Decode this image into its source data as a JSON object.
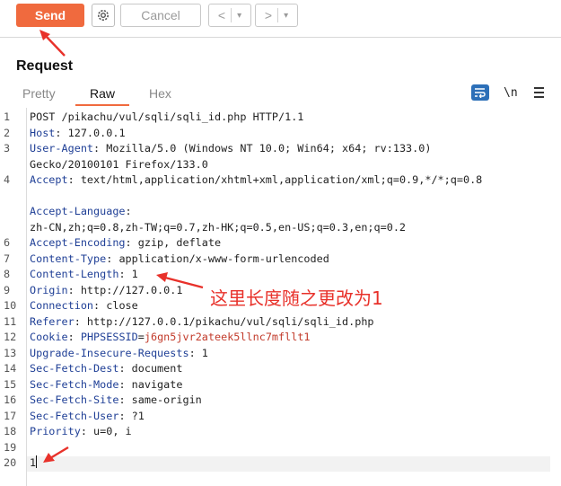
{
  "toolbar": {
    "send_label": "Send",
    "cancel_label": "Cancel",
    "back_glyph": "<",
    "forward_glyph": ">",
    "dropdown_glyph": "▾",
    "settings_icon": "gear-icon"
  },
  "section_title": "Request",
  "tabs": {
    "pretty": "Pretty",
    "raw": "Raw",
    "hex": "Hex",
    "newline_toggle": "\\n"
  },
  "colors": {
    "accent": "#f06a3e",
    "header_key": "#1f3f96",
    "cookie_value": "#c23a2a",
    "annotation": "#e8312a",
    "wrap_button": "#2c6fb8"
  },
  "annotation_note": "这里长度随之更改为1",
  "request_lines": [
    {
      "num": "1",
      "key": "",
      "value": "POST /pikachu/vul/sqli/sqli_id.php HTTP/1.1"
    },
    {
      "num": "2",
      "key": "Host",
      "value": ": 127.0.0.1"
    },
    {
      "num": "3",
      "key": "User-Agent",
      "value": ": Mozilla/5.0 (Windows NT 10.0; Win64; x64; rv:133.0)"
    },
    {
      "num": "",
      "key": "",
      "value": "Gecko/20100101 Firefox/133.0"
    },
    {
      "num": "4",
      "key": "Accept",
      "value": ": text/html,application/xhtml+xml,application/xml;q=0.9,*/*;q=0.8"
    },
    {
      "num": "",
      "key": "",
      "value": ""
    },
    {
      "num": "",
      "key": "Accept-Language",
      "value": ":"
    },
    {
      "num": "",
      "key": "",
      "value": "zh-CN,zh;q=0.8,zh-TW;q=0.7,zh-HK;q=0.5,en-US;q=0.3,en;q=0.2"
    },
    {
      "num": "6",
      "key": "Accept-Encoding",
      "value": ": gzip, deflate"
    },
    {
      "num": "7",
      "key": "Content-Type",
      "value": ": application/x-www-form-urlencoded"
    },
    {
      "num": "8",
      "key": "Content-Length",
      "value": ": 1"
    },
    {
      "num": "9",
      "key": "Origin",
      "value": ": http://127.0.0.1"
    },
    {
      "num": "10",
      "key": "Connection",
      "value": ": close"
    },
    {
      "num": "11",
      "key": "Referer",
      "value": ": http://127.0.0.1/pikachu/vul/sqli/sqli_id.php"
    },
    {
      "num": "12",
      "key": "Cookie",
      "value": ": ",
      "cookie_name": "PHPSESSID",
      "cookie_value": "j6gn5jvr2ateek5llnc7mfllt1"
    },
    {
      "num": "13",
      "key": "Upgrade-Insecure-Requests",
      "value": ": 1"
    },
    {
      "num": "14",
      "key": "Sec-Fetch-Dest",
      "value": ": document"
    },
    {
      "num": "15",
      "key": "Sec-Fetch-Mode",
      "value": ": navigate"
    },
    {
      "num": "16",
      "key": "Sec-Fetch-Site",
      "value": ": same-origin"
    },
    {
      "num": "17",
      "key": "Sec-Fetch-User",
      "value": ": ?1"
    },
    {
      "num": "18",
      "key": "Priority",
      "value": ": u=0, i"
    },
    {
      "num": "19",
      "key": "",
      "value": ""
    },
    {
      "num": "20",
      "key": "",
      "value": "1"
    }
  ]
}
